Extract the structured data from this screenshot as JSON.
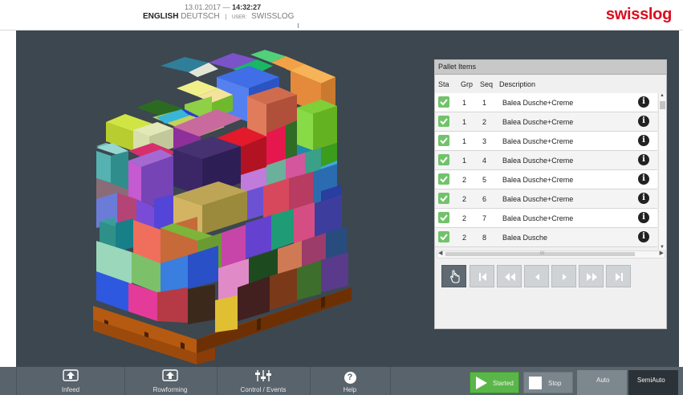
{
  "header": {
    "date": "13.01.2017 —",
    "time": "14:32:27",
    "languages": [
      "ENGLISH",
      "DEUTSCH"
    ],
    "user_label": "USER:",
    "user": "SWISSLOG",
    "logo": "swisslog",
    "brand_color": "#dc0d1f"
  },
  "pallet_panel": {
    "title": "Pallet Items",
    "columns": [
      "Sta",
      "Grp",
      "Seq",
      "Description"
    ],
    "rows": [
      {
        "status": "check-icon",
        "grp": "1",
        "seq": "1",
        "description": "Balea Dusche+Creme"
      },
      {
        "status": "check-icon",
        "grp": "1",
        "seq": "2",
        "description": "Balea Dusche+Creme"
      },
      {
        "status": "check-icon",
        "grp": "1",
        "seq": "3",
        "description": "Balea Dusche+Creme"
      },
      {
        "status": "check-icon",
        "grp": "1",
        "seq": "4",
        "description": "Balea Dusche+Creme"
      },
      {
        "status": "check-icon",
        "grp": "2",
        "seq": "5",
        "description": "Balea Dusche+Creme"
      },
      {
        "status": "check-icon",
        "grp": "2",
        "seq": "6",
        "description": "Balea Dusche+Creme"
      },
      {
        "status": "check-icon",
        "grp": "2",
        "seq": "7",
        "description": "Balea Dusche+Creme"
      },
      {
        "status": "check-icon",
        "grp": "2",
        "seq": "8",
        "description": "Balea Dusche"
      }
    ],
    "info_glyph": "i",
    "scrollbar_glyphs": {
      "up": "▲",
      "down": "▼",
      "left": "◀",
      "right": "▶",
      "grip": "III"
    },
    "nav_buttons": [
      "hand-icon",
      "first-icon",
      "fast-back-icon",
      "back-icon",
      "forward-icon",
      "fast-forward-icon",
      "last-icon"
    ]
  },
  "footer": {
    "tabs": [
      {
        "label": "Infeed",
        "icon": "infeed-icon"
      },
      {
        "label": "Rowforming",
        "icon": "rowforming-icon"
      },
      {
        "label": "Control / Events",
        "icon": "sliders-icon"
      },
      {
        "label": "Help",
        "icon": "help-icon"
      }
    ],
    "help_glyph": "?",
    "started_label": "Started",
    "stop_label": "Stop",
    "auto_label": "Auto",
    "semiauto_label": "SemiAuto",
    "started_color": "#5bb64a"
  }
}
